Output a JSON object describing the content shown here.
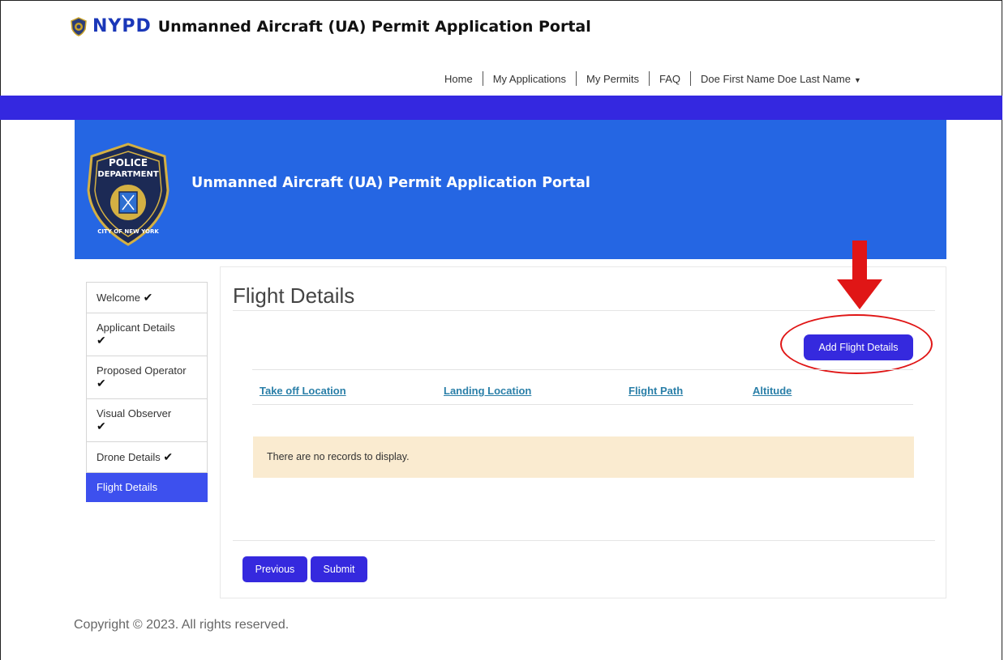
{
  "header": {
    "brand_mark": "NYPD",
    "title": "Unmanned Aircraft (UA) Permit Application Portal"
  },
  "topnav": {
    "items": [
      "Home",
      "My Applications",
      "My Permits",
      "FAQ"
    ],
    "user_name": "Doe First Name Doe Last Name"
  },
  "banner": {
    "title": "Unmanned Aircraft (UA) Permit Application Portal",
    "logo_text_top": "POLICE",
    "logo_text_mid": "DEPARTMENT",
    "logo_text_bottom": "CITY OF NEW YORK"
  },
  "sidebar": {
    "items": [
      {
        "label": "Welcome",
        "check": "✔"
      },
      {
        "label": "Applicant Details",
        "check": "✔"
      },
      {
        "label": "Proposed Operator",
        "check": "✔"
      },
      {
        "label": "Visual Observer",
        "check": "✔"
      },
      {
        "label": "Drone Details",
        "check": "✔"
      },
      {
        "label": "Flight Details",
        "check": ""
      }
    ]
  },
  "main": {
    "page_title": "Flight Details",
    "add_button": "Add Flight Details",
    "columns": [
      "Take off Location",
      "Landing Location",
      "Flight Path",
      "Altitude"
    ],
    "empty_message": "There are no records to display.",
    "previous_button": "Previous",
    "submit_button": "Submit"
  },
  "footer": {
    "copyright": "Copyright © 2023. All rights reserved."
  },
  "colors": {
    "accent": "#3529de",
    "banner": "#2566e3",
    "band": "#3428e0",
    "highlight": "#e01616",
    "empty_bg": "#faebd0"
  }
}
